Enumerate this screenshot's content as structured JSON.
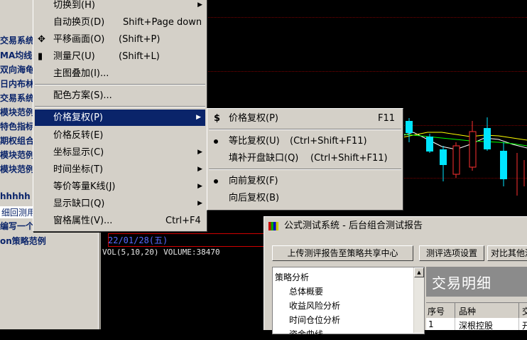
{
  "sidebar": {
    "items": [
      {
        "label": "交易系统",
        "style": "hl"
      },
      {
        "label": "MA均线",
        "style": "hl"
      },
      {
        "label": "双向海龟",
        "style": "hl"
      },
      {
        "label": "日内布林",
        "style": "hl"
      },
      {
        "label": "交易系统",
        "style": "hl"
      },
      {
        "label": "模块范例",
        "style": "hl"
      },
      {
        "label": "特色指标",
        "style": "hl"
      },
      {
        "label": "期权组合",
        "style": "hl"
      },
      {
        "label": "模块范例",
        "style": "hl"
      },
      {
        "label": "模块范例",
        "style": "hl"
      },
      {
        "label": "hhhhh",
        "style": "hl"
      },
      {
        "label": "细回测用",
        "style": "sel"
      },
      {
        "label": "编写一个",
        "style": "hl"
      },
      {
        "label": "on策略范例",
        "style": "hl"
      }
    ]
  },
  "chart": {
    "date_label": "22/01/28(五)",
    "volume_label": "VOL(5,10,20) VOLUME:38470"
  },
  "menu": {
    "items": [
      {
        "label": "切换到(H)",
        "shortcut": "",
        "submenu": true
      },
      {
        "label": "自动换页(D)",
        "shortcut": "Shift+Page down",
        "submenu": false
      },
      {
        "label": "平移画面(O)",
        "shortcut": "(Shift+P)",
        "submenu": false,
        "icon": "move-icon"
      },
      {
        "label": "测量尺(U)",
        "shortcut": "(Shift+L)",
        "submenu": false,
        "icon": "ruler-icon"
      },
      {
        "label": "主图叠加(I)...",
        "shortcut": "",
        "submenu": false
      },
      {
        "label": "配色方案(S)...",
        "shortcut": "",
        "submenu": false
      },
      {
        "label": "价格复权(P)",
        "shortcut": "",
        "submenu": true,
        "active": true
      },
      {
        "label": "价格反转(E)",
        "shortcut": "",
        "submenu": false
      },
      {
        "label": "坐标显示(C)",
        "shortcut": "",
        "submenu": true
      },
      {
        "label": "时间坐标(T)",
        "shortcut": "",
        "submenu": true
      },
      {
        "label": "等价等量K线(J)",
        "shortcut": "",
        "submenu": true
      },
      {
        "label": "显示缺口(Q)",
        "shortcut": "",
        "submenu": true
      },
      {
        "label": "窗格属性(V)...",
        "shortcut": "Ctrl+F4",
        "submenu": false
      }
    ]
  },
  "submenu": {
    "items": [
      {
        "label": "价格复权(P)",
        "shortcut": "F11",
        "icon": "dollar-icon"
      },
      {
        "label": "等比复权(U)",
        "shortcut": "(Ctrl+Shift+F11)",
        "bullet": true
      },
      {
        "label": "填补开盘缺口(Q)",
        "shortcut": "(Ctrl+Shift+F11)"
      },
      {
        "label": "向前复权(F)",
        "shortcut": "",
        "bullet": true
      },
      {
        "label": "向后复权(B)",
        "shortcut": ""
      }
    ]
  },
  "report": {
    "title": "公式测试系统 - 后台组合测试报告",
    "upload_button": "上传测评报告至策略共享中心",
    "options_button": "测评选项设置",
    "compare_button": "对比其他测",
    "tree": [
      "策略分析",
      "总体概要",
      "收益风险分析",
      "时间仓位分析",
      "资金曲线"
    ],
    "banner": "交易明细",
    "columns": [
      "序号",
      "品种",
      "交"
    ],
    "row": [
      "1",
      "深根控股",
      "开"
    ]
  },
  "colors": {
    "menu_bg": "#d4d0c8",
    "highlight": "#0a246a",
    "up_candle": "#ff3030",
    "down_candle": "#00e5ff"
  }
}
